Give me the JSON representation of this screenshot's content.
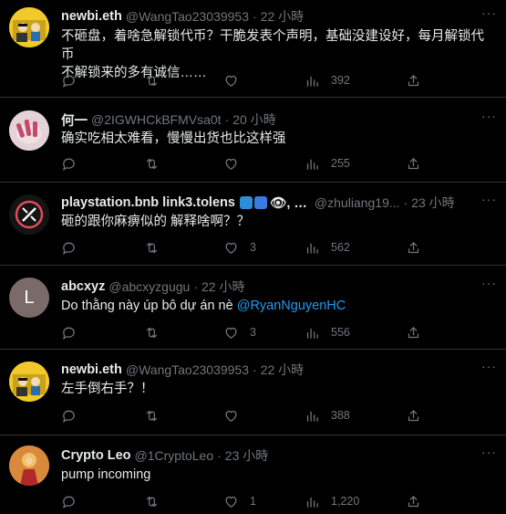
{
  "tweets": [
    {
      "name": "newbi.eth",
      "handle": "@WangTao23039953",
      "time": "22 小時",
      "text": "不砸盘，着啥急解锁代币？干脆发表个声明，基础没建设好，每月解锁代币\n不解锁来的多有诚信……",
      "likes": "",
      "views": "392"
    },
    {
      "name": "何一",
      "handle": "@2IGWHCkBFMVsa0t",
      "time": "20 小時",
      "text": "确实吃相太难看，慢慢出货也比这样强",
      "likes": "",
      "views": "255"
    },
    {
      "name": "playstation.bnb link3.tolens",
      "name_suffix": "👁, …",
      "handle": "@zhuliang19...",
      "time": "23 小時",
      "text": "砸的跟你麻痹似的 解释啥啊？？",
      "likes": "3",
      "views": "562"
    },
    {
      "name": "abcxyz",
      "avatar_letter": "L",
      "handle": "@abcxyzgugu",
      "time": "22 小時",
      "text": "Do thằng này úp bô dự án nè ",
      "mention": "@RyanNguyenHC",
      "likes": "3",
      "views": "556"
    },
    {
      "name": "newbi.eth",
      "handle": "@WangTao23039953",
      "time": "22 小時",
      "text": "左手倒右手？！",
      "likes": "",
      "views": "388"
    },
    {
      "name": "Crypto Leo",
      "handle": "@1CryptoLeo",
      "time": "23 小時",
      "text": "pump incoming",
      "likes": "1",
      "views": "1,220"
    }
  ],
  "ui": {
    "dot": "·",
    "more": "···"
  },
  "colors": {
    "background": "#000000",
    "text": "#e7e9ea",
    "muted": "#71767b",
    "link": "#1d9bf0",
    "divider": "#2f3336"
  }
}
